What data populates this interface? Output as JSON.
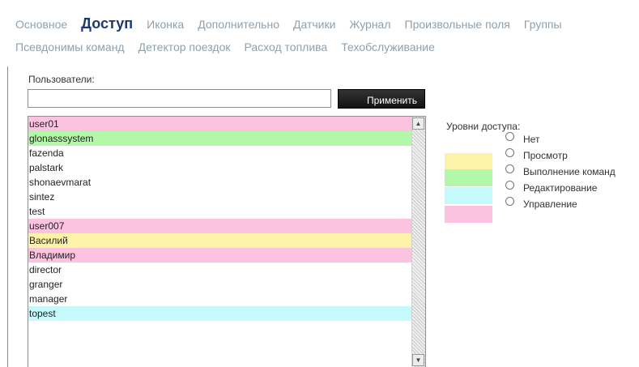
{
  "tabs": {
    "row1": [
      "Основное",
      "Доступ",
      "Иконка",
      "Дополнительно",
      "Датчики",
      "Журнал",
      "Произвольные поля",
      "Группы"
    ],
    "row2": [
      "Псевдонимы команд",
      "Детектор поездок",
      "Расход топлива",
      "Техобслуживание"
    ],
    "active": "Доступ"
  },
  "users": {
    "label": "Пользователи:",
    "search_value": "",
    "apply_label": "Применить",
    "list": [
      {
        "name": "user01",
        "level": "Управление"
      },
      {
        "name": "glonasssystem",
        "level": "Выполнение команд"
      },
      {
        "name": "fazenda",
        "level": "Нет"
      },
      {
        "name": "palstark",
        "level": "Нет"
      },
      {
        "name": "shonaevmarat",
        "level": "Нет"
      },
      {
        "name": "sintez",
        "level": "Нет"
      },
      {
        "name": "test",
        "level": "Нет"
      },
      {
        "name": "user007",
        "level": "Управление"
      },
      {
        "name": "Василий",
        "level": "Просмотр"
      },
      {
        "name": "Владимир",
        "level": "Управление"
      },
      {
        "name": "director",
        "level": "Нет"
      },
      {
        "name": "granger",
        "level": "Нет"
      },
      {
        "name": "manager",
        "level": "Нет"
      },
      {
        "name": "topest",
        "level": "Редактирование"
      }
    ]
  },
  "access_levels": {
    "title": "Уровни доступа:",
    "items": [
      {
        "label": "Нет",
        "color": "#ffffff"
      },
      {
        "label": "Просмотр",
        "color": "#fdf3a8"
      },
      {
        "label": "Выполнение команд",
        "color": "#b3f7a8"
      },
      {
        "label": "Редактирование",
        "color": "#c4fafb"
      },
      {
        "label": "Управление",
        "color": "#fbc3e0"
      }
    ]
  },
  "icons": {
    "scroll_up": "triangle-up-icon",
    "scroll_down": "triangle-down-icon"
  }
}
